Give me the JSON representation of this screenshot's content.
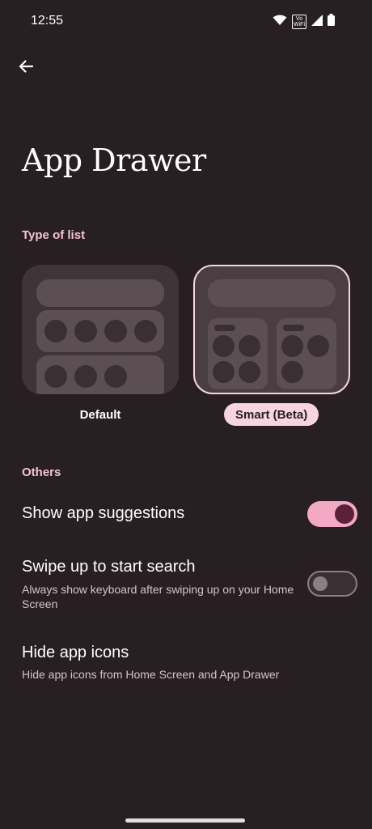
{
  "status_bar": {
    "time": "12:55",
    "volte_line1": "Vo",
    "volte_line2": "WiFi",
    "icons": [
      "wifi-icon",
      "volte-icon",
      "signal-icon",
      "battery-icon"
    ]
  },
  "header": {
    "back_icon": "back-arrow-icon",
    "title": "App Drawer"
  },
  "type_of_list": {
    "header": "Type of list",
    "options": [
      {
        "label": "Default",
        "selected": false
      },
      {
        "label": "Smart (Beta)",
        "selected": true
      }
    ]
  },
  "others": {
    "header": "Others",
    "items": [
      {
        "title": "Show app suggestions",
        "subtitle": "",
        "toggle": true
      },
      {
        "title": "Swipe up to start search",
        "subtitle": "Always show keyboard after swiping up on your Home Screen",
        "toggle": false
      },
      {
        "title": "Hide app icons",
        "subtitle": "Hide app icons from Home Screen and App Drawer"
      }
    ]
  },
  "colors": {
    "background": "#271f22",
    "accent": "#f3c4d3",
    "selected_chip": "#f7d5df",
    "toggle_on_track": "#f3a9c4",
    "toggle_on_knob": "#5a2138"
  }
}
